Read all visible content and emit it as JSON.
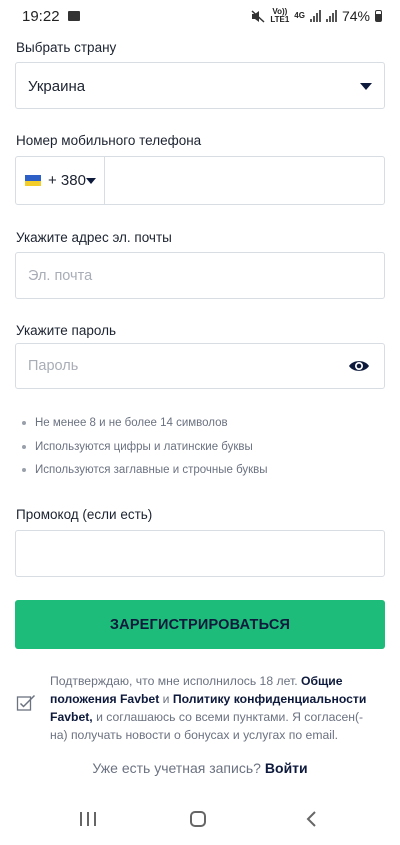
{
  "status_bar": {
    "time": "19:22",
    "network_top": "Vo))",
    "network_bottom": "LTE1",
    "network_type": "4G",
    "battery": "74%",
    "icons": [
      "image-icon",
      "mute-icon",
      "signal-icon",
      "battery-icon"
    ]
  },
  "country": {
    "label": "Выбрать страну",
    "value": "Украина"
  },
  "phone": {
    "label": "Номер мобильного телефона",
    "code": "+ 380",
    "flag_colors": [
      "#2d5fc6",
      "#f3cd29"
    ]
  },
  "email": {
    "label": "Укажите адрес эл. почты",
    "placeholder": "Эл. почта"
  },
  "password": {
    "label": "Укажите пароль",
    "placeholder": "Пароль",
    "rules": [
      "Не менее 8 и не более 14 символов",
      "Используются цифры и латинские буквы",
      "Используются заглавные и строчные буквы"
    ]
  },
  "promo": {
    "label": "Промокод (если есть)"
  },
  "register_button": "ЗАРЕГИСТРИРОВАТЬСЯ",
  "consent": {
    "part1": "Подтверждаю, что мне исполнилось 18 лет.",
    "link1": "Общие положения Favbet",
    "part2": "и",
    "link2": "Политику конфиденциальности Favbet,",
    "part3": "и соглашаюсь со всеми пунктами. Я согласен(-на) получать новости о бонусах и услугах по email."
  },
  "login": {
    "question": "Уже есть учетная запись?",
    "link": "Войти"
  },
  "colors": {
    "accent_green": "#1dbc7a",
    "dark_navy": "#0e1a3c",
    "border": "#d8dce3"
  }
}
